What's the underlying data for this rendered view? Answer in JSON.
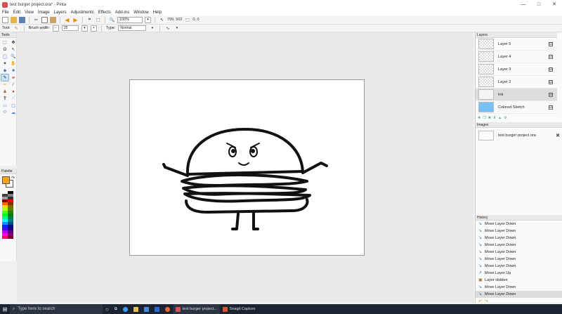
{
  "window": {
    "title": "test burger project.ora* - Pinta",
    "controls": [
      "—",
      "□",
      "✕"
    ]
  },
  "menu": [
    "File",
    "Edit",
    "View",
    "Image",
    "Layers",
    "Adjustments",
    "Effects",
    "Add-ins",
    "Window",
    "Help"
  ],
  "toolbar": {
    "zoom": "100%",
    "cursor_pos": "799, 502",
    "selection_size": "0, 0"
  },
  "tool_options": {
    "tool_label": "Tool:",
    "brush_width_label": "Brush width:",
    "brush_width": "25",
    "type_label": "Type:",
    "type_value": "Normal"
  },
  "tools_panel": {
    "title": "Tools"
  },
  "palette": {
    "title": "Palette",
    "primary_color": "#f4a21f",
    "secondary_color": "#ffffff"
  },
  "layers_panel": {
    "title": "Layers",
    "items": [
      {
        "name": "Layer 5",
        "visible": "☑"
      },
      {
        "name": "Layer 4",
        "visible": "☑"
      },
      {
        "name": "Layer 3",
        "visible": "☑"
      },
      {
        "name": "Layer 2",
        "visible": "☑"
      },
      {
        "name": "Ink",
        "visible": "☑"
      },
      {
        "name": "Colored Sketch",
        "visible": "☑"
      }
    ]
  },
  "images_panel": {
    "title": "Images",
    "items": [
      {
        "name": "test burger project.ora"
      }
    ]
  },
  "history_panel": {
    "title": "History",
    "items": [
      "Move Layer Down",
      "Move Layer Down",
      "Move Layer Down",
      "Move Layer Down",
      "Move Layer Down",
      "Move Layer Down",
      "Move Layer Down",
      "Move Layer Up",
      "Layer Hidden",
      "Move Layer Down",
      "Move Layer Down"
    ]
  },
  "taskbar": {
    "search_placeholder": "Type here to search",
    "apps": [
      "test burger project...",
      "Snagit Capture"
    ]
  }
}
